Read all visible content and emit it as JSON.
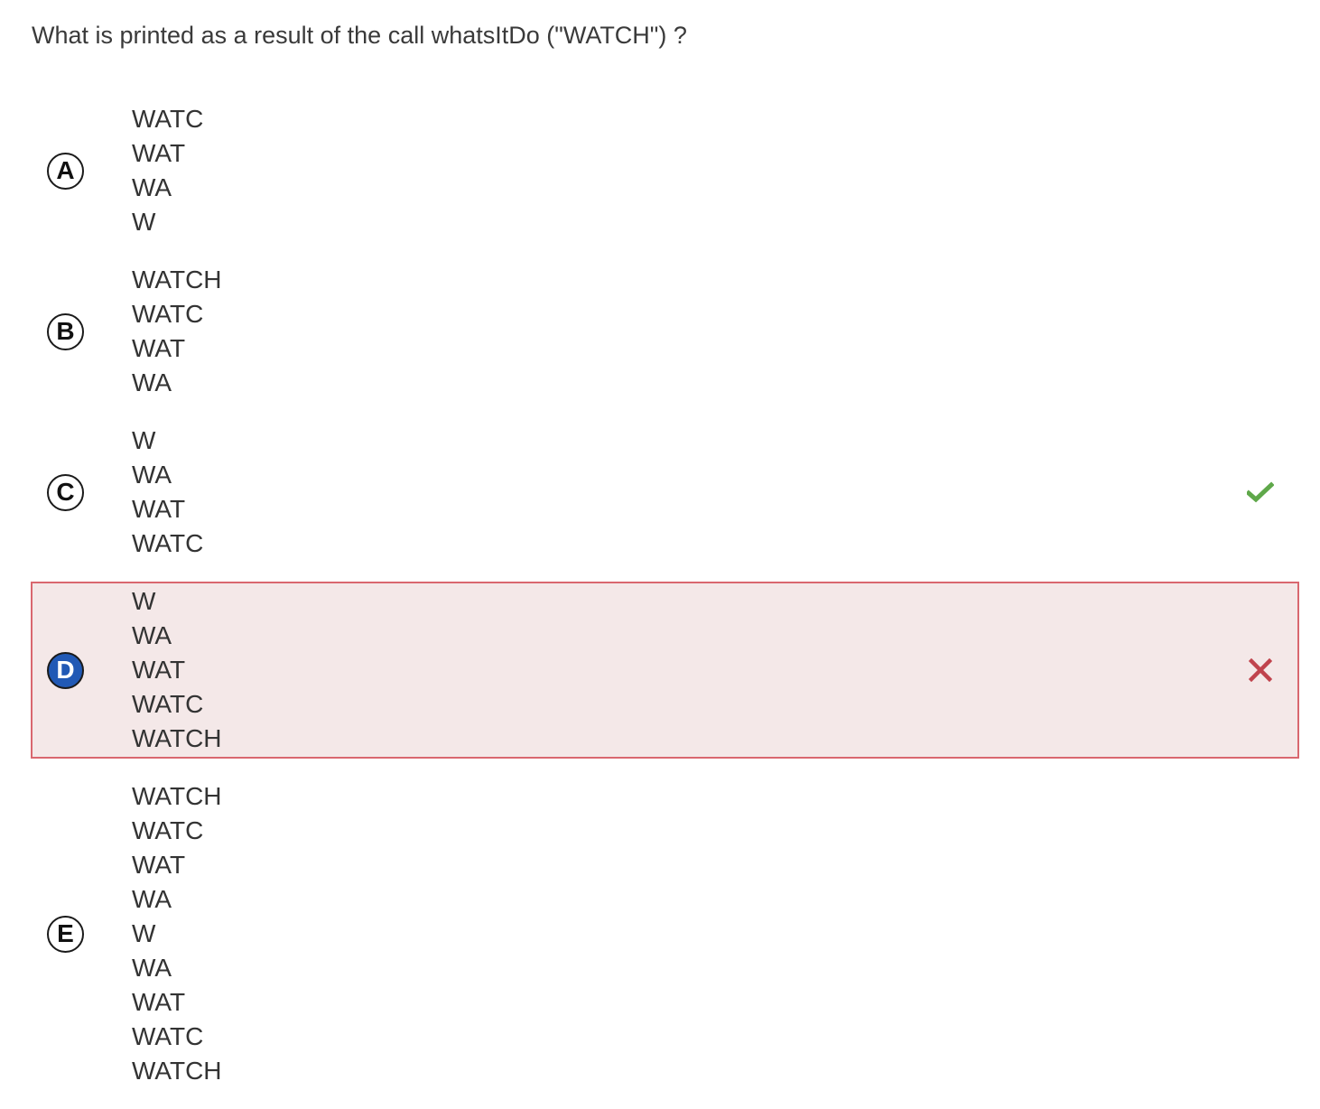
{
  "question": {
    "text": "What is printed as a result of the call whatsItDo (\"WATCH\") ?"
  },
  "colors": {
    "correct": "#5fa84a",
    "incorrect": "#c0434d",
    "selected_badge": "#2159b5",
    "selected_bg": "#f4e8e8",
    "selected_border": "#d9676f"
  },
  "choices": [
    {
      "letter": "A",
      "lines": [
        "WATC",
        "WAT",
        "WA",
        "W"
      ],
      "status": "none",
      "selected": false
    },
    {
      "letter": "B",
      "lines": [
        "WATCH",
        "WATC",
        "WAT",
        "WA"
      ],
      "status": "none",
      "selected": false
    },
    {
      "letter": "C",
      "lines": [
        "W",
        "WA",
        "WAT",
        "WATC"
      ],
      "status": "correct",
      "selected": false,
      "icon": "check-icon"
    },
    {
      "letter": "D",
      "lines": [
        "W",
        "WA",
        "WAT",
        "WATC",
        "WATCH"
      ],
      "status": "incorrect",
      "selected": true,
      "icon": "cross-icon"
    },
    {
      "letter": "E",
      "lines": [
        "WATCH",
        "WATC",
        "WAT",
        "WA",
        "W",
        "WA",
        "WAT",
        "WATC",
        "WATCH"
      ],
      "status": "none",
      "selected": false
    }
  ]
}
